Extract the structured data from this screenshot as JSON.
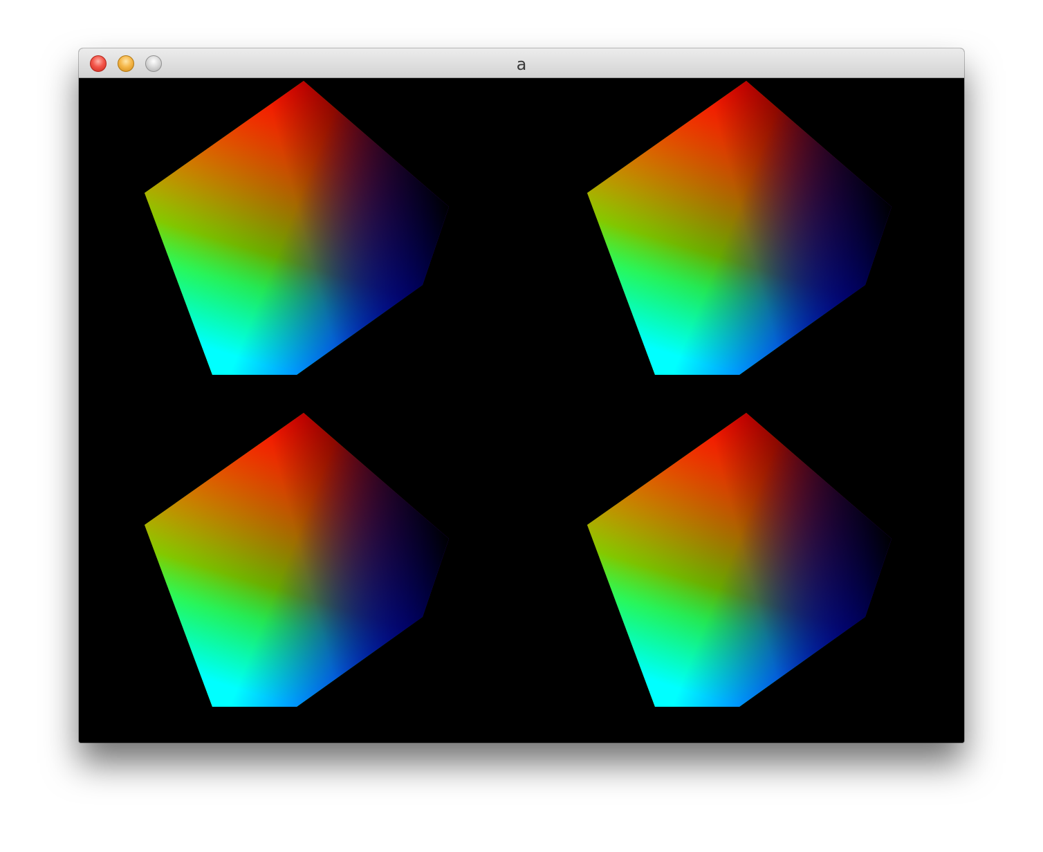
{
  "window": {
    "title": "a"
  },
  "canvas": {
    "background": "#000000",
    "pentagon_count": 4,
    "vertex_colors": [
      "#ff0000",
      "#000000",
      "#0000ff",
      "#00ffff",
      "#00ff00",
      "#ffff00"
    ]
  },
  "icons": {
    "close": "close-button",
    "minimize": "minimize-button",
    "zoom": "zoom-button"
  }
}
